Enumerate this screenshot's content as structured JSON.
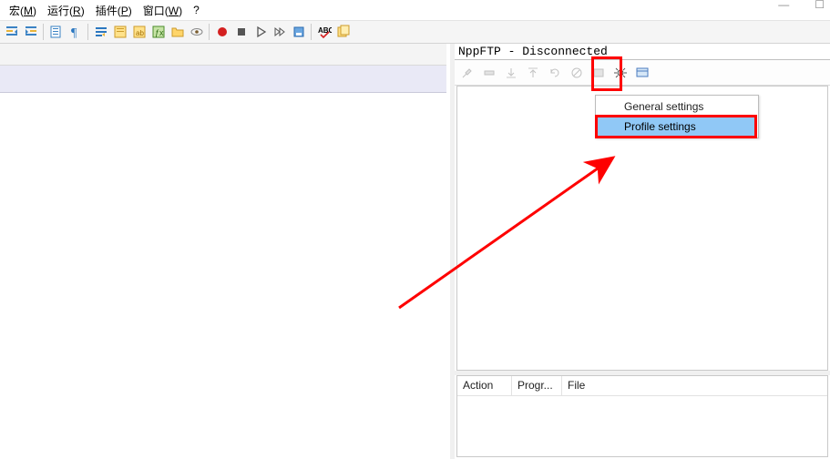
{
  "menu": {
    "items": [
      {
        "label": "宏",
        "key": "M"
      },
      {
        "label": "运行",
        "key": "R"
      },
      {
        "label": "插件",
        "key": "P"
      },
      {
        "label": "窗口",
        "key": "W"
      },
      {
        "label": "?",
        "key": ""
      }
    ]
  },
  "toolbar": {
    "icons": [
      "indent-left-icon",
      "indent-right-icon",
      "sep",
      "pilcrow-icon",
      "sep",
      "wrap-icon",
      "guide-icon",
      "lang-icon",
      "func-icon",
      "folder-icon",
      "eye-icon",
      "sep",
      "macro-record-icon",
      "macro-stop-icon",
      "macro-play-icon",
      "macro-fast-icon",
      "macro-save-icon",
      "sep",
      "spellcheck-icon",
      "doc-compare-icon"
    ]
  },
  "panel": {
    "title": "NppFTP - Disconnected",
    "toolbar_icons": [
      {
        "name": "connect-icon",
        "active": false
      },
      {
        "name": "disconnect-icon",
        "active": false
      },
      {
        "name": "download-icon",
        "active": false
      },
      {
        "name": "upload-icon",
        "active": false
      },
      {
        "name": "refresh-icon",
        "active": false
      },
      {
        "name": "abort-icon",
        "active": false
      },
      {
        "name": "rawcmd-icon",
        "active": false
      },
      {
        "name": "settings-gear-icon",
        "active": true
      },
      {
        "name": "messages-icon",
        "active": true
      }
    ],
    "dropdown": {
      "general": "General settings",
      "profile": "Profile settings"
    },
    "log_columns": {
      "action": "Action",
      "progress": "Progr...",
      "file": "File"
    }
  }
}
